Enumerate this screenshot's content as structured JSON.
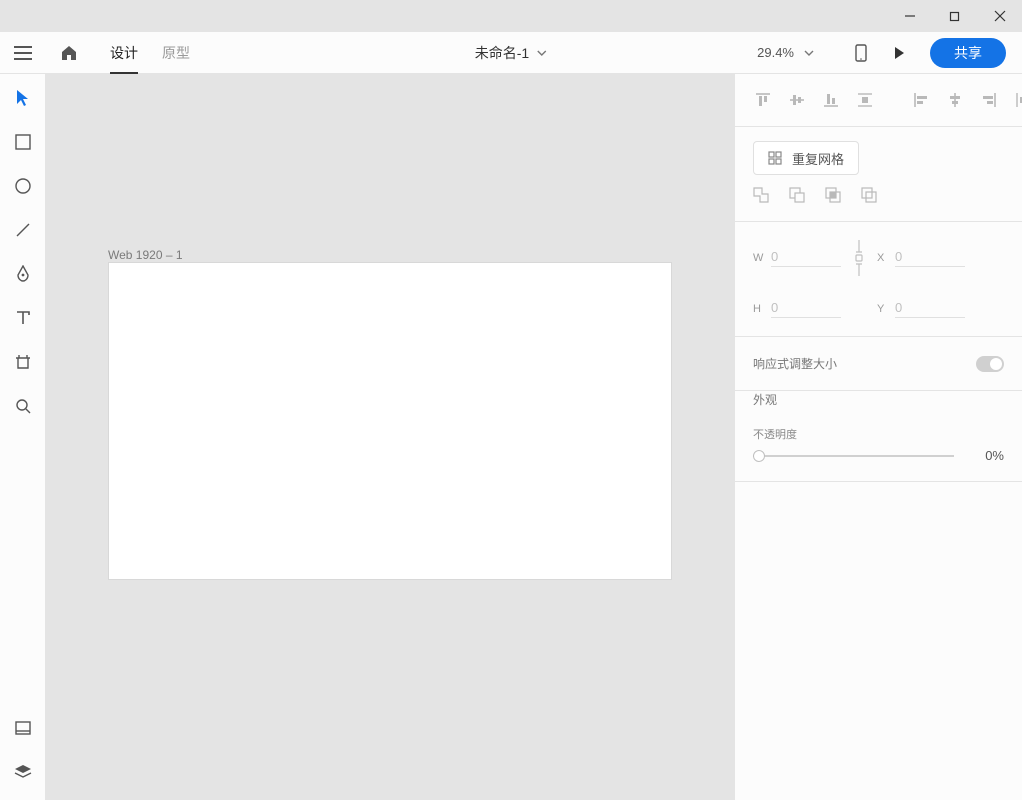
{
  "window": {
    "title_unused": ""
  },
  "topbar": {
    "tabs": {
      "design": "设计",
      "prototype": "原型"
    },
    "doc_title": "未命名-1",
    "zoom": "29.4%",
    "share": "共享"
  },
  "canvas": {
    "artboard_label": "Web 1920 – 1"
  },
  "panel": {
    "repeat_grid": "重复网格",
    "dims": {
      "w_label": "W",
      "h_label": "H",
      "x_label": "X",
      "y_label": "Y",
      "w": "0",
      "h": "0",
      "x": "0",
      "y": "0"
    },
    "responsive_resize": "响应式调整大小",
    "appearance": "外观",
    "opacity_label": "不透明度",
    "opacity_value": "0%"
  }
}
